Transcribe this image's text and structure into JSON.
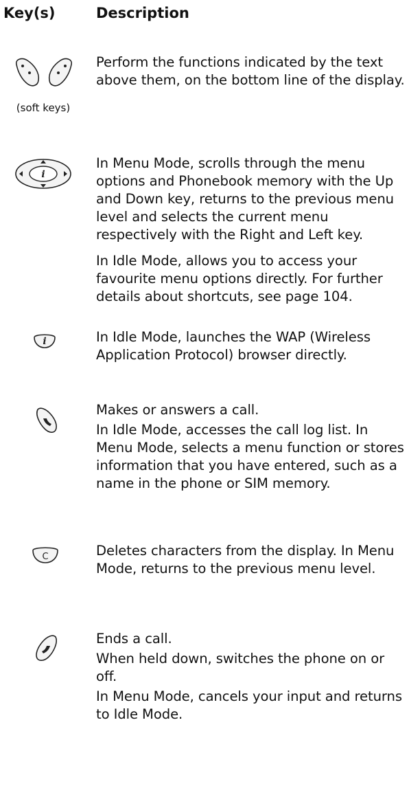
{
  "header": {
    "keys_label": "Key(s)",
    "description_label": "Description"
  },
  "rows": [
    {
      "icon": "soft-keys-icon",
      "caption": "(soft keys)",
      "paragraphs": [
        "Perform the functions indicated by the text above them, on the bottom line of the display."
      ]
    },
    {
      "icon": "navigation-keys-icon",
      "paragraphs": [
        "In Menu Mode, scrolls through the menu options and Phonebook memory with the Up and Down key, returns to the previous menu level and selects the current menu respectively with the Right and Left key.",
        "In Idle Mode, allows you to access your favourite menu options directly. For further details about shortcuts, see page 104."
      ]
    },
    {
      "icon": "wap-browser-key-icon",
      "paragraphs": [
        "In Idle Mode, launches the WAP (Wireless Application Protocol) browser directly."
      ]
    },
    {
      "icon": "send-key-icon",
      "paragraphs": [
        "Makes or answers a call.",
        "In Idle Mode, accesses the call log list. In Menu Mode, selects a menu function or stores information that you have entered, such as a name in the phone or SIM memory."
      ]
    },
    {
      "icon": "clear-key-icon",
      "paragraphs": [
        "Deletes characters from the display. In Menu Mode, returns to the previous menu level."
      ]
    },
    {
      "icon": "end-key-icon",
      "paragraphs": [
        "Ends a call.",
        "When held down, switches the phone on or off.",
        "In Menu Mode, cancels your input and returns to Idle Mode."
      ]
    }
  ]
}
